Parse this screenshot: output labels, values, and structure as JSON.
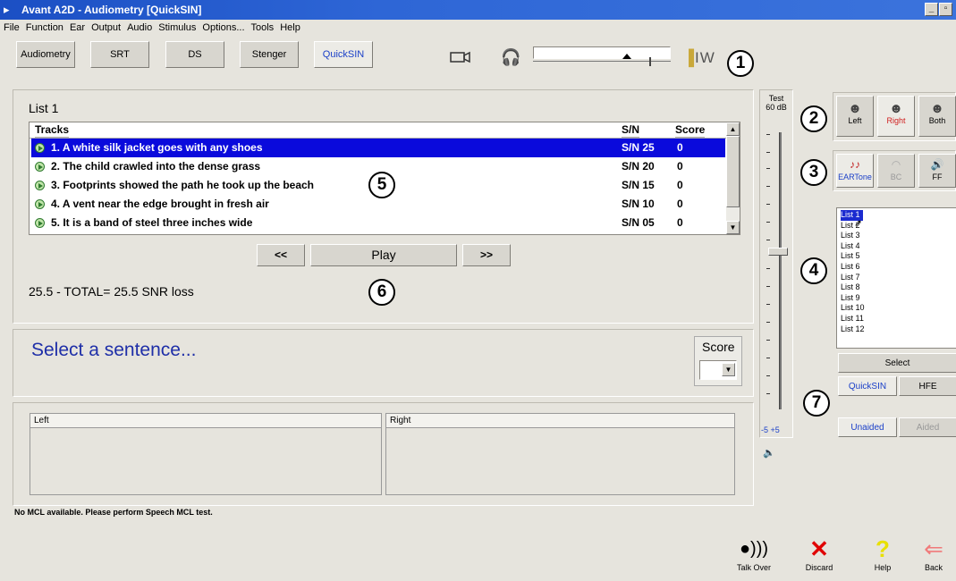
{
  "window": {
    "title": "Avant A2D - Audiometry [QuickSIN]"
  },
  "menu": [
    "File",
    "Function",
    "Ear",
    "Output",
    "Audio",
    "Stimulus",
    "Options...",
    "Tools",
    "Help"
  ],
  "tabs": [
    {
      "label": "Audiometry",
      "active": false
    },
    {
      "label": "SRT",
      "active": false
    },
    {
      "label": "DS",
      "active": false
    },
    {
      "label": "Stenger",
      "active": false
    },
    {
      "label": "QuickSIN",
      "active": true
    }
  ],
  "toolbar": {
    "iw_label": "IW"
  },
  "callouts": [
    "1",
    "2",
    "3",
    "4",
    "5",
    "6",
    "7"
  ],
  "tracks_panel": {
    "list_title": "List 1",
    "headers": {
      "tracks": "Tracks",
      "sn": "S/N",
      "score": "Score"
    },
    "rows": [
      {
        "text": "1. A white silk jacket goes with any shoes",
        "sn": "S/N 25",
        "score": "0",
        "selected": true
      },
      {
        "text": "2. The child crawled into the dense grass",
        "sn": "S/N 20",
        "score": "0",
        "selected": false
      },
      {
        "text": "3. Footprints showed the path he took up the beach",
        "sn": "S/N 15",
        "score": "0",
        "selected": false
      },
      {
        "text": "4. A vent near the edge brought in fresh air",
        "sn": "S/N 10",
        "score": "0",
        "selected": false
      },
      {
        "text": "5. It is a band of steel three inches wide",
        "sn": "S/N 05",
        "score": "0",
        "selected": false
      }
    ]
  },
  "navigation": {
    "prev": "<<",
    "play": "Play",
    "next": ">>"
  },
  "result_text": "25.5 - TOTAL= 25.5 SNR loss",
  "prompt_text": "Select a sentence...",
  "score_label": "Score",
  "ear_panels": {
    "left": "Left",
    "right": "Right"
  },
  "level": {
    "test_label": "Test",
    "db_label": "60 dB",
    "bottom_label": "-5  +5"
  },
  "ear_buttons": [
    {
      "label": "Left",
      "icon": "head-left-icon"
    },
    {
      "label": "Right",
      "icon": "head-right-icon"
    },
    {
      "label": "Both",
      "icon": "head-both-icon"
    }
  ],
  "transducers": [
    {
      "label": "EARTone",
      "icon": "eartone-icon"
    },
    {
      "label": "BC",
      "icon": "bone-conductor-icon"
    },
    {
      "label": "FF",
      "icon": "free-field-speaker-icon"
    }
  ],
  "lists": [
    "List 1",
    "List 2",
    "List 3",
    "List 4",
    "List 5",
    "List 6",
    "List 7",
    "List 8",
    "List 9",
    "List 10",
    "List 11",
    "List 12"
  ],
  "select_button": "Select",
  "mode_buttons": [
    "QuickSIN",
    "HFE"
  ],
  "aid_buttons": [
    "Unaided",
    "Aided"
  ],
  "status": "No MCL available. Please perform Speech MCL test.",
  "actions": [
    {
      "label": "Talk Over",
      "icon": "talk-over-icon"
    },
    {
      "label": "Discard",
      "icon": "discard-icon"
    },
    {
      "label": "Help",
      "icon": "help-icon"
    },
    {
      "label": "Back",
      "icon": "back-arrow-icon"
    }
  ],
  "colors": {
    "title_bar": "#2e66d6",
    "selection": "#0a0adc",
    "accent_blue": "#1a3fc8",
    "prompt_blue": "#1f2fa8",
    "discard_red": "#e00000",
    "help_yellow": "#e8e000",
    "back_pink": "#f07a7a"
  }
}
